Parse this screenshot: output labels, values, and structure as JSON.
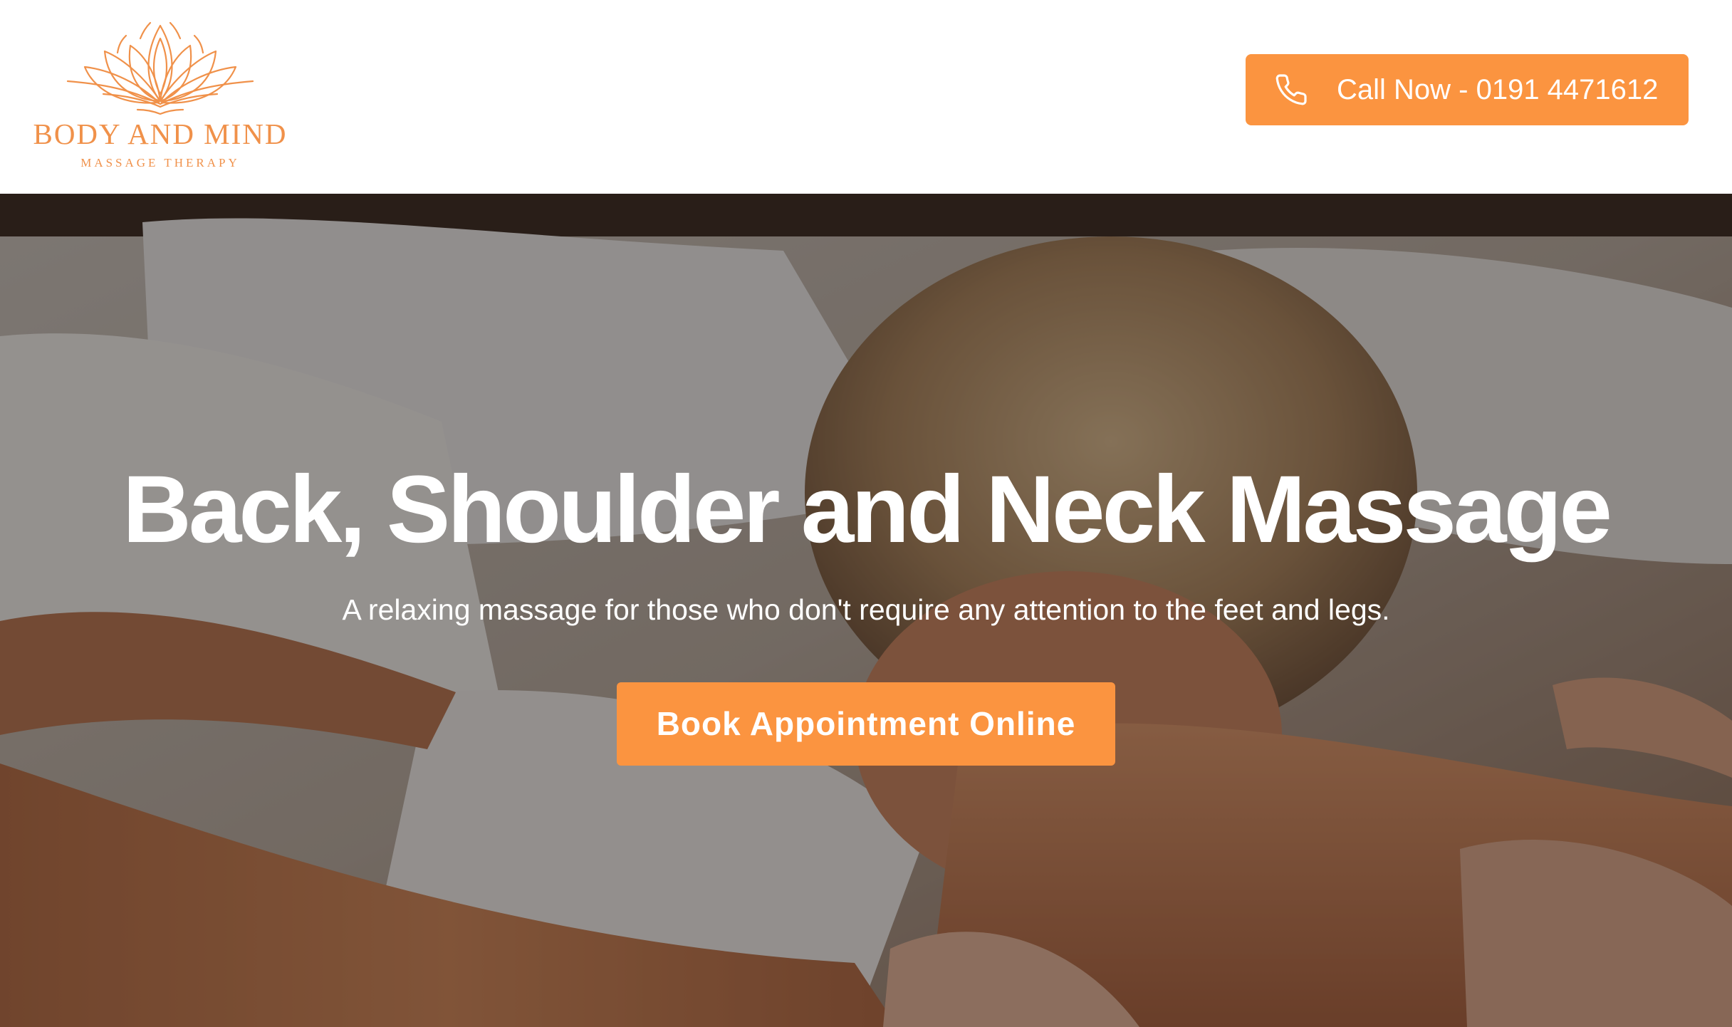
{
  "brand": {
    "name": "BODY AND MIND",
    "tagline": "MASSAGE THERAPY",
    "accent_color": "#fb9440",
    "logo_icon": "lotus-icon"
  },
  "header": {
    "call_button": {
      "icon": "phone-icon",
      "label": "Call Now - 0191 4471612"
    }
  },
  "hero": {
    "title": "Back, Shoulder and Neck Massage",
    "subtitle": "A relaxing massage for those who don't require any attention to the feet and legs.",
    "cta_label": "Book Appointment Online"
  }
}
